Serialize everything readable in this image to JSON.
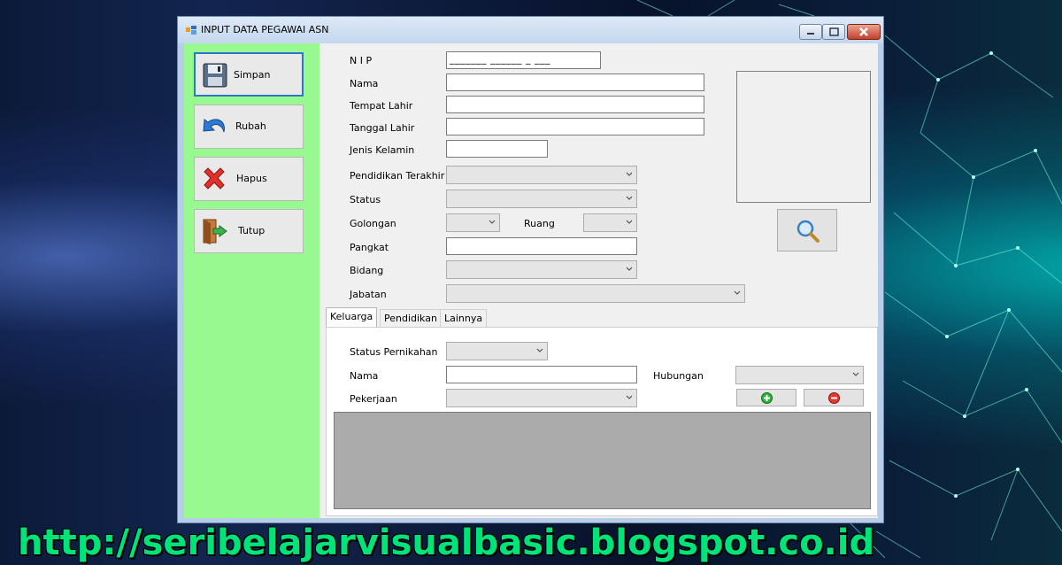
{
  "window": {
    "title": "INPUT DATA PEGAWAI ASN"
  },
  "sidebar": {
    "buttons": [
      {
        "label": "Simpan",
        "icon": "floppy-disk-icon"
      },
      {
        "label": "Rubah",
        "icon": "undo-arrow-icon"
      },
      {
        "label": "Hapus",
        "icon": "red-x-icon"
      },
      {
        "label": "Tutup",
        "icon": "exit-door-icon"
      }
    ]
  },
  "form": {
    "nip_label": "N I P",
    "nip_mask": "_______ ______ _ ___",
    "nama_label": "Nama",
    "tempat_lahir_label": "Tempat Lahir",
    "tanggal_lahir_label": "Tanggal Lahir",
    "jenis_kelamin_label": "Jenis Kelamin",
    "pendidikan_label": "Pendidikan Terakhir",
    "status_label": "Status",
    "golongan_label": "Golongan",
    "ruang_label": "Ruang",
    "pangkat_label": "Pangkat",
    "bidang_label": "Bidang",
    "jabatan_label": "Jabatan"
  },
  "photo": {
    "search_icon": "magnifier-icon"
  },
  "tabs": [
    {
      "label": "Keluarga"
    },
    {
      "label": "Pendidikan"
    },
    {
      "label": "Lainnya"
    }
  ],
  "keluarga": {
    "status_pernikahan_label": "Status Pernikahan",
    "nama_label": "Nama",
    "hubungan_label": "Hubungan",
    "pekerjaan_label": "Pekerjaan",
    "add_icon": "green-plus-icon",
    "remove_icon": "red-minus-icon"
  },
  "footer": {
    "url": "http://seribelajarvisualbasic.blogspot.co.id"
  },
  "colors": {
    "sidebar": "#99f991",
    "accent": "#2e76c9",
    "footer_text": "#00e37a"
  }
}
